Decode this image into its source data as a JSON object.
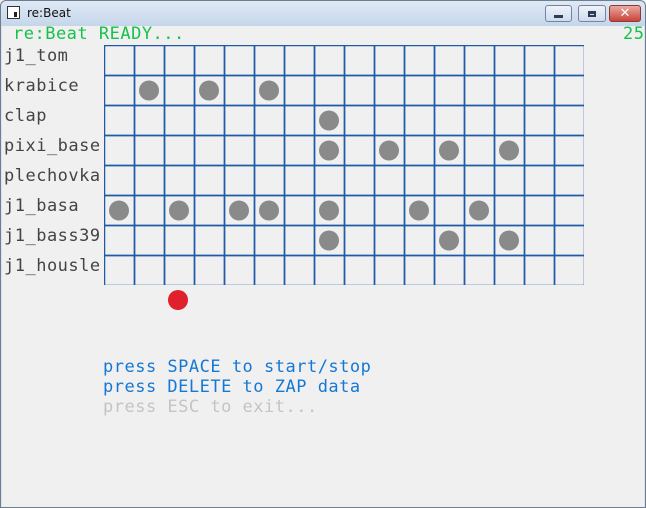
{
  "window": {
    "title": "re:Beat",
    "icon": "app-icon",
    "controls": [
      "minimize-icon",
      "maximize-icon",
      "close-icon"
    ]
  },
  "status": {
    "text": "re:Beat READY...",
    "counter": "25",
    "color": "#16c24a"
  },
  "sequencer": {
    "steps": 16,
    "tracks": [
      {
        "name": "j1_tom",
        "active_steps": []
      },
      {
        "name": "krabice",
        "active_steps": [
          1,
          3,
          5
        ]
      },
      {
        "name": "clap",
        "active_steps": [
          7
        ]
      },
      {
        "name": "pixi_base",
        "active_steps": [
          7,
          9,
          11,
          13
        ]
      },
      {
        "name": "plechovka",
        "active_steps": []
      },
      {
        "name": "j1_basa",
        "active_steps": [
          0,
          2,
          4,
          5,
          7,
          10,
          12
        ]
      },
      {
        "name": "j1_bass39",
        "active_steps": [
          7,
          11,
          13
        ]
      },
      {
        "name": "j1_housle",
        "active_steps": []
      }
    ],
    "playhead_step": 2,
    "grid_color": "#1e5aa8",
    "note_color": "#8a8a8a",
    "playhead_color": "#e0202a"
  },
  "help": {
    "line1": "press SPACE to start/stop",
    "line2": "press DELETE to ZAP data",
    "line3": "press ESC to exit..."
  }
}
